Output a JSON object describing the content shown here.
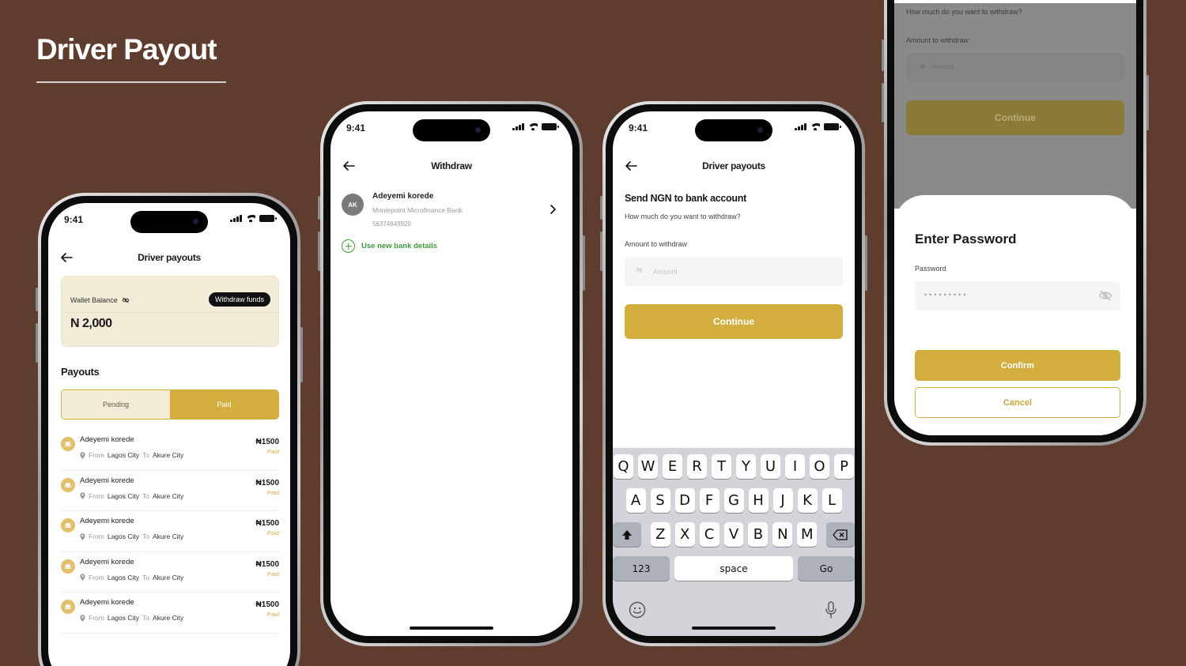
{
  "page": {
    "title": "Driver Payout"
  },
  "colors": {
    "background": "#5e3d2e",
    "accent": "#d4ad3f",
    "success": "#3f9c3a"
  },
  "status_bar": {
    "time": "9:41"
  },
  "screen1": {
    "nav_title": "Driver payouts",
    "wallet_label": "Wallet Balance",
    "wallet_amount": "N 2,000",
    "withdraw_button": "Withdraw funds",
    "section_title": "Payouts",
    "tabs": [
      {
        "label": "Pending",
        "active": false
      },
      {
        "label": "Paid",
        "active": true
      }
    ],
    "payouts": [
      {
        "name": "Adeyemi korede",
        "from_word": "From",
        "from": "Lagos City",
        "to_word": "To",
        "to": "Akure City",
        "amount": "₦1500",
        "status": "Paid"
      },
      {
        "name": "Adeyemi korede",
        "from_word": "From",
        "from": "Lagos City",
        "to_word": "To",
        "to": "Akure City",
        "amount": "₦1500",
        "status": "Paid"
      },
      {
        "name": "Adeyemi korede",
        "from_word": "From",
        "from": "Lagos City",
        "to_word": "To",
        "to": "Akure City",
        "amount": "₦1500",
        "status": "Paid"
      },
      {
        "name": "Adeyemi korede",
        "from_word": "From",
        "from": "Lagos City",
        "to_word": "To",
        "to": "Akure City",
        "amount": "₦1500",
        "status": "Paid"
      },
      {
        "name": "Adeyemi korede",
        "from_word": "From",
        "from": "Lagos City",
        "to_word": "To",
        "to": "Akure City",
        "amount": "₦1500",
        "status": "Paid"
      }
    ]
  },
  "screen2": {
    "nav_title": "Withdraw",
    "account": {
      "initials": "AK",
      "name": "Adeyemi korede",
      "bank": "Moniepoint Microfinance Bank",
      "number": "56374849920"
    },
    "new_bank_label": "Use new bank details"
  },
  "screen3": {
    "nav_title": "Driver payouts",
    "heading": "Send NGN to bank account",
    "question": "How much do you want to withdraw?",
    "amount_label": "Amount to withdraw",
    "amount_placeholder": "Amount",
    "currency_prefix": "₦",
    "continue_button": "Continue",
    "keyboard": {
      "row1": [
        "Q",
        "W",
        "E",
        "R",
        "T",
        "Y",
        "U",
        "I",
        "O",
        "P"
      ],
      "row2": [
        "A",
        "S",
        "D",
        "F",
        "G",
        "H",
        "J",
        "K",
        "L"
      ],
      "row3": [
        "Z",
        "X",
        "C",
        "V",
        "B",
        "N",
        "M"
      ],
      "numbers_key": "123",
      "space_key": "space",
      "go_key": "Go"
    }
  },
  "screen4": {
    "question": "How much do you want to withdraw?",
    "amount_label": "Amount to withdraw",
    "amount_placeholder": "Amount",
    "currency_prefix": "₦",
    "continue_button": "Continue",
    "sheet_title": "Enter Password",
    "password_label": "Password",
    "password_mask": "•••••••••",
    "confirm_button": "Confirm",
    "cancel_button": "Cancel"
  }
}
